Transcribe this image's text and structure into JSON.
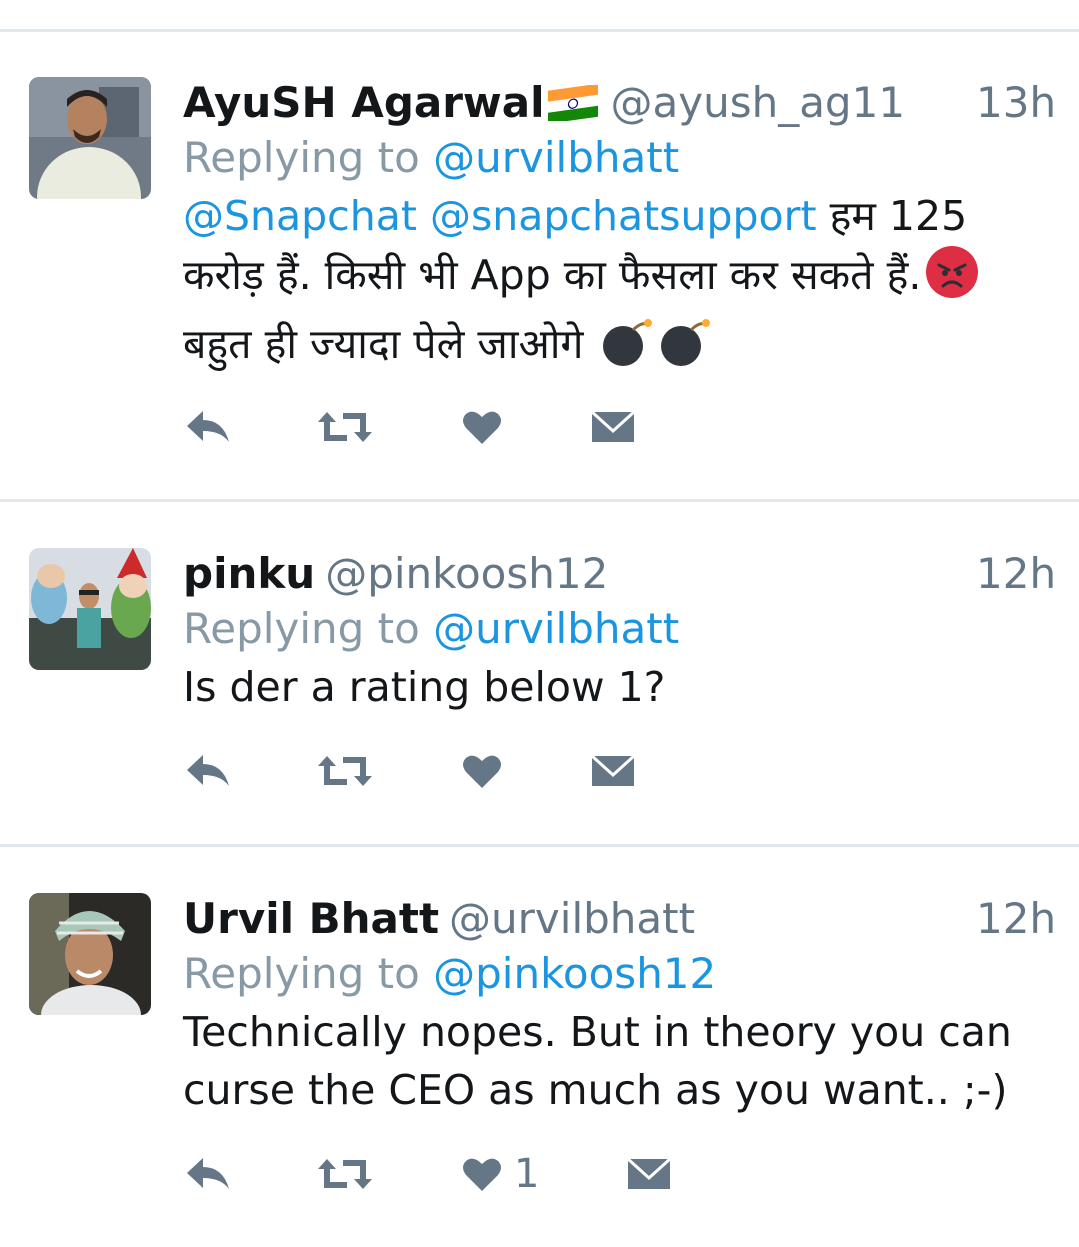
{
  "colors": {
    "link": "#1b95e0",
    "muted": "#657786",
    "text": "#14171a",
    "icon": "#657786",
    "divider": "#e1e8ed"
  },
  "tweets": [
    {
      "name": "AyuSH Agarwal",
      "handle": "@ayush_ag11",
      "time": "13h",
      "replying_prefix": "Replying to ",
      "replying_to": "@urvilbhatt",
      "mention1": "@Snapchat",
      "mention2": "@snapchatsupport",
      "text_line1_rest": " हम 125",
      "text_line2": "करोड़ हैं. किसी भी App का फैसला कर सकते हैं.",
      "text_line3": "बहुत ही ज्यादा पेले जाओगे",
      "emojis": [
        "indian-flag",
        "angry-face",
        "bomb",
        "bomb"
      ],
      "like_count": ""
    },
    {
      "name": "pinku",
      "handle": "@pinkoosh12",
      "time": "12h",
      "replying_prefix": "Replying to ",
      "replying_to": "@urvilbhatt",
      "text": "Is der a rating below 1?",
      "like_count": ""
    },
    {
      "name": "Urvil Bhatt",
      "handle": "@urvilbhatt",
      "time": "12h",
      "replying_prefix": "Replying to ",
      "replying_to": "@pinkoosh12",
      "text_line1": "Technically nopes. But in theory you can",
      "text_line2": "curse the CEO as much as you want.. ;-)",
      "like_count": "1"
    }
  ]
}
